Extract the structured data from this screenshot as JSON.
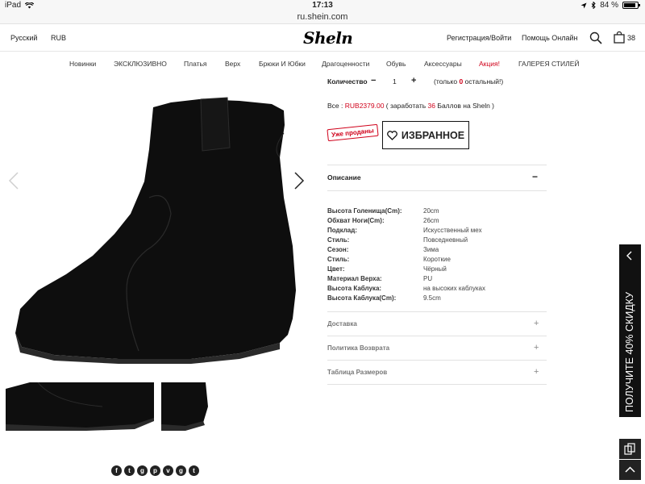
{
  "status_bar": {
    "device": "iPad",
    "time": "17:13",
    "battery": "84 %"
  },
  "url": "ru.shein.com",
  "header": {
    "language": "Русский",
    "currency": "RUB",
    "logo": "Sheln",
    "register_login": "Регистрация/Войти",
    "help_online": "Помощь Онлайн",
    "cart_count": "38"
  },
  "nav": {
    "items": [
      "Новинки",
      "ЭКСКЛЮЗИВНО",
      "Платья",
      "Верх",
      "Брюки И Юбки",
      "Драгоценности",
      "Обувь",
      "Аксессуары",
      "Акция!",
      "ГАЛЕРЕЯ СТИЛЕЙ"
    ]
  },
  "product": {
    "quantity_label": "Количество",
    "quantity_minus": "−",
    "quantity_value": "1",
    "quantity_plus": "+",
    "stock_prefix": "(только",
    "stock_count": "0",
    "stock_suffix": "остальный!)",
    "price_prefix": "Все :",
    "price": "RUB2379.00",
    "points_prefix": "( заработать",
    "points": "36",
    "points_suffix": "Баллов на Sheln )",
    "sold_out": "Уже проданы",
    "favorite_label": "ИЗБРАННОЕ"
  },
  "description": {
    "title": "Описание",
    "toggle": "−",
    "specs": [
      {
        "key": "Высота Голенища(Cm):",
        "value": "20cm"
      },
      {
        "key": "Обхват Ноги(Cm):",
        "value": "26cm"
      },
      {
        "key": "Подклад:",
        "value": "Искусственный мех"
      },
      {
        "key": "Стиль:",
        "value": "Повседневный"
      },
      {
        "key": "Сезон:",
        "value": "Зима"
      },
      {
        "key": "Стиль:",
        "value": "Короткие"
      },
      {
        "key": "Цвет:",
        "value": "Чёрный"
      },
      {
        "key": "Материал Верха:",
        "value": "PU"
      },
      {
        "key": "Высота Каблука:",
        "value": "на высоких каблуках"
      },
      {
        "key": "Высота Каблука(Cm):",
        "value": "9.5cm"
      }
    ]
  },
  "accordions": [
    {
      "label": "Доставка",
      "toggle": "+"
    },
    {
      "label": "Политика Возврата",
      "toggle": "+"
    },
    {
      "label": "Таблица Размеров",
      "toggle": "+"
    }
  ],
  "promo": {
    "text": "ПОЛУЧИТЕ 40% СКИДКУ"
  },
  "social": [
    "f",
    "t",
    "g",
    "p",
    "v",
    "g",
    "t"
  ],
  "colors": {
    "accent_red": "#d0021b",
    "promo_bg": "#111111"
  }
}
